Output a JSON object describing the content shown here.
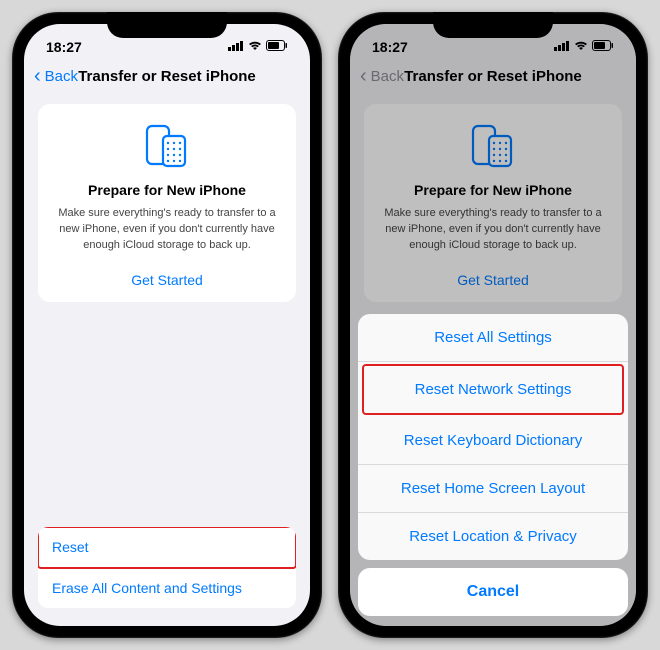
{
  "statusbar": {
    "time": "18:27"
  },
  "nav": {
    "back_label": "Back",
    "title": "Transfer or Reset iPhone"
  },
  "card": {
    "heading": "Prepare for New iPhone",
    "body": "Make sure everything's ready to transfer to a new iPhone, even if you don't currently have enough iCloud storage to back up.",
    "cta": "Get Started"
  },
  "bottom": {
    "reset": "Reset",
    "erase": "Erase All Content and Settings"
  },
  "sheet": {
    "items": [
      "Reset All Settings",
      "Reset Network Settings",
      "Reset Keyboard Dictionary",
      "Reset Home Screen Layout",
      "Reset Location & Privacy"
    ],
    "cancel": "Cancel"
  },
  "colors": {
    "accent": "#007aff",
    "danger": "#e02020"
  }
}
